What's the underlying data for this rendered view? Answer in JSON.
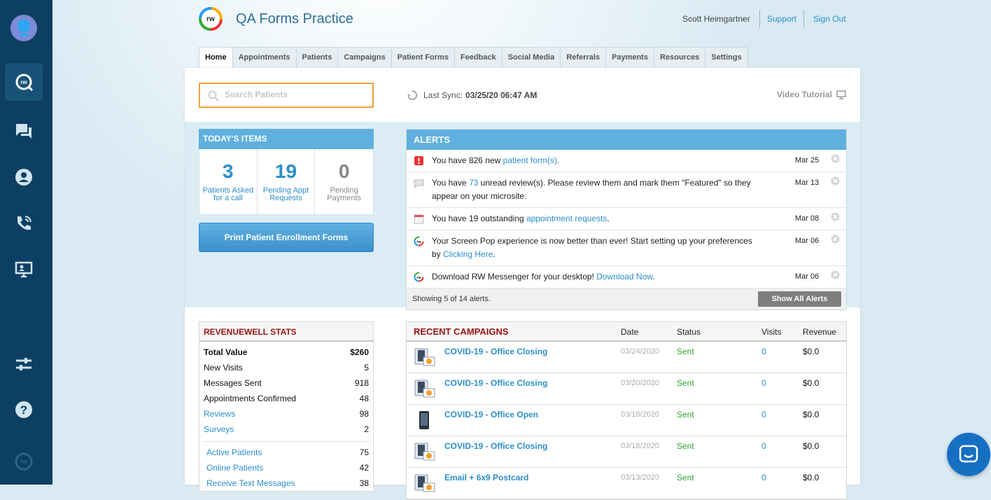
{
  "app": {
    "title": "QA Forms Practice",
    "logo_text": "rw"
  },
  "header": {
    "user": "Scott Heimgartner",
    "support": "Support",
    "signout": "Sign Out"
  },
  "tabs": [
    "Home",
    "Appointments",
    "Patients",
    "Campaigns",
    "Patient Forms",
    "Feedback",
    "Social Media",
    "Referrals",
    "Payments",
    "Resources",
    "Settings"
  ],
  "search": {
    "placeholder": "Search Patients"
  },
  "sync": {
    "label": "Last Sync:",
    "value": "03/25/20 06:47 AM"
  },
  "video": {
    "label": "Video Tutorial"
  },
  "today": {
    "title": "TODAY'S ITEMS",
    "items": [
      {
        "value": "3",
        "label": "Patients Asked for a call"
      },
      {
        "value": "19",
        "label": "Pending Appt Requests"
      },
      {
        "value": "0",
        "label": "Pending Payments"
      }
    ],
    "print_button": "Print Patient Enrollment Forms"
  },
  "alerts": {
    "title": "ALERTS",
    "items": [
      {
        "pre": "You have 826 new ",
        "link": "patient form(s)",
        "post": ".",
        "date": "Mar 25",
        "icon": "form-icon"
      },
      {
        "pre": "You have ",
        "link": "73",
        "post": " unread review(s). Please review them and mark them \"Featured\" so they appear on your microsite.",
        "date": "Mar 13",
        "icon": "review-icon"
      },
      {
        "pre": "You have 19 outstanding ",
        "link": "appointment requests",
        "post": ".",
        "date": "Mar 08",
        "icon": "calendar-icon"
      },
      {
        "pre": "Your Screen Pop experience is now better than ever! Start setting up your preferences by ",
        "link": "Clicking Here",
        "post": ".",
        "date": "Mar 06",
        "icon": "rw-icon"
      },
      {
        "pre": "Download RW Messenger for your desktop! ",
        "link": "Download Now",
        "post": ".",
        "date": "Mar 06",
        "icon": "rw-icon"
      }
    ],
    "footer": "Showing 5 of 14 alerts.",
    "show_all": "Show All Alerts"
  },
  "stats": {
    "title": "REVENUEWELL STATS",
    "rows": [
      {
        "k": "Total Value",
        "v": "$260",
        "style": "bold"
      },
      {
        "k": "New Visits",
        "v": "5",
        "style": ""
      },
      {
        "k": "Messages Sent",
        "v": "918",
        "style": ""
      },
      {
        "k": "Appointments Confirmed",
        "v": "48",
        "style": ""
      },
      {
        "k": "Reviews",
        "v": "98",
        "style": "link"
      },
      {
        "k": "Surveys",
        "v": "2",
        "style": "link"
      }
    ],
    "rows2": [
      {
        "k": "Active Patients",
        "v": "75"
      },
      {
        "k": "Online Patients",
        "v": "42"
      },
      {
        "k": "Receive Text Messages",
        "v": "38"
      }
    ]
  },
  "campaigns": {
    "title": "RECENT CAMPAIGNS",
    "headers": {
      "date": "Date",
      "status": "Status",
      "visits": "Visits",
      "revenue": "Revenue"
    },
    "rows": [
      {
        "name": "COVID-19 - Office Closing",
        "date": "03/24/2020",
        "status": "Sent",
        "visits": "0",
        "revenue": "$0.0",
        "icon": "email-phone-icon"
      },
      {
        "name": "COVID-19 - Office Closing",
        "date": "03/20/2020",
        "status": "Sent",
        "visits": "0",
        "revenue": "$0.0",
        "icon": "email-phone-icon"
      },
      {
        "name": "COVID-19 - Office Open",
        "date": "03/18/2020",
        "status": "Sent",
        "visits": "0",
        "revenue": "$0.0",
        "icon": "phone-icon"
      },
      {
        "name": "COVID-19 - Office Closing",
        "date": "03/18/2020",
        "status": "Sent",
        "visits": "0",
        "revenue": "$0.0",
        "icon": "email-phone-icon"
      },
      {
        "name": "Email + 6x9 Postcard",
        "date": "03/13/2020",
        "status": "Sent",
        "visits": "0",
        "revenue": "$0.0",
        "icon": "email-phone-icon"
      }
    ]
  },
  "colors": {
    "rail": "#0d3f63",
    "accent": "#2b8fc9",
    "panel_head": "#5fb0df",
    "search_border": "#f1a33e"
  }
}
